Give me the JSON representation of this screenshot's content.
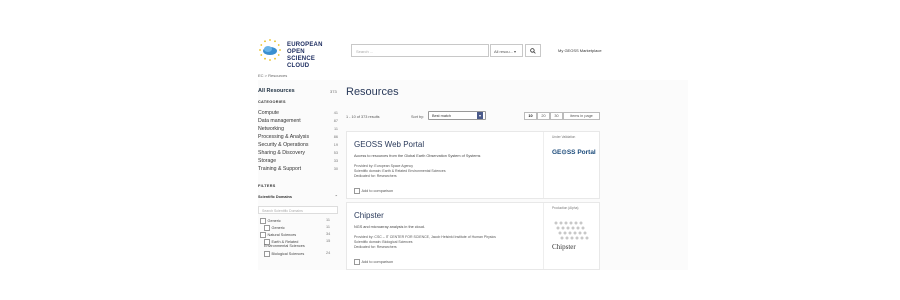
{
  "header": {
    "logo_line1": "EUROPEAN OPEN",
    "logo_line2": "SCIENCE CLOUD",
    "search_placeholder": "Search ...",
    "search_scope": "All resou...",
    "top_link": "My GEOSS Marketplace"
  },
  "breadcrumb": "EC > Resources",
  "sidebar": {
    "all_label": "All Resources",
    "all_count": "373",
    "categories_heading": "CATEGORIES",
    "categories": [
      {
        "label": "Compute",
        "count": "41"
      },
      {
        "label": "Data management",
        "count": "87"
      },
      {
        "label": "Networking",
        "count": "11"
      },
      {
        "label": "Processing & Analysis",
        "count": "86"
      },
      {
        "label": "Security & Operations",
        "count": "19"
      },
      {
        "label": "Sharing & Discovery",
        "count": "53"
      },
      {
        "label": "Storage",
        "count": "33"
      },
      {
        "label": "Training & Support",
        "count": "30"
      }
    ],
    "filters_heading": "FILTERS",
    "filter_scientific": "Scientific Domains",
    "filter_search_placeholder": "Search Scientific Domains",
    "filter_items": [
      {
        "label": "Generic",
        "count": "11"
      },
      {
        "label": "Generic",
        "count": "11"
      },
      {
        "label": "Natural Sciences",
        "count": "34"
      },
      {
        "label": "Earth & Related",
        "count": "15"
      },
      {
        "label": "Environmental Sciences",
        "count": ""
      },
      {
        "label": "Biological Sciences",
        "count": "24"
      }
    ]
  },
  "main": {
    "title": "Resources",
    "results": "1 - 10 of 373 results",
    "sort_label": "Sort by:",
    "sort_value": "Best match",
    "per_page": [
      "10",
      "20",
      "30"
    ],
    "per_page_label": "items in page"
  },
  "cards": [
    {
      "title": "GEOSS Web Portal",
      "desc": "Access to resources from the Global Earth Observation System of Systems",
      "provided": "Provided by:   European Space Agency",
      "domain": "Scientific domain:   Earth & Related Environmental Sciences",
      "dedicated": "Dedicated for:   Researchers",
      "compare": "Add to comparison",
      "badge": "Under Validation",
      "logo": "GE⊙SS Portal"
    },
    {
      "title": "Chipster",
      "desc": "NGS and microarray analysis in the cloud.",
      "provided": "Provided by:   CSC – IT CENTER FOR SCIENCE, Jacob Helsinki Institute of Human Physics",
      "domain": "Scientific domain:   Biological Sciences",
      "dedicated": "Dedicated for:   Researchers",
      "compare": "Add to comparison",
      "badge": "Production (Alpha)",
      "logo": "Chipster"
    }
  ]
}
